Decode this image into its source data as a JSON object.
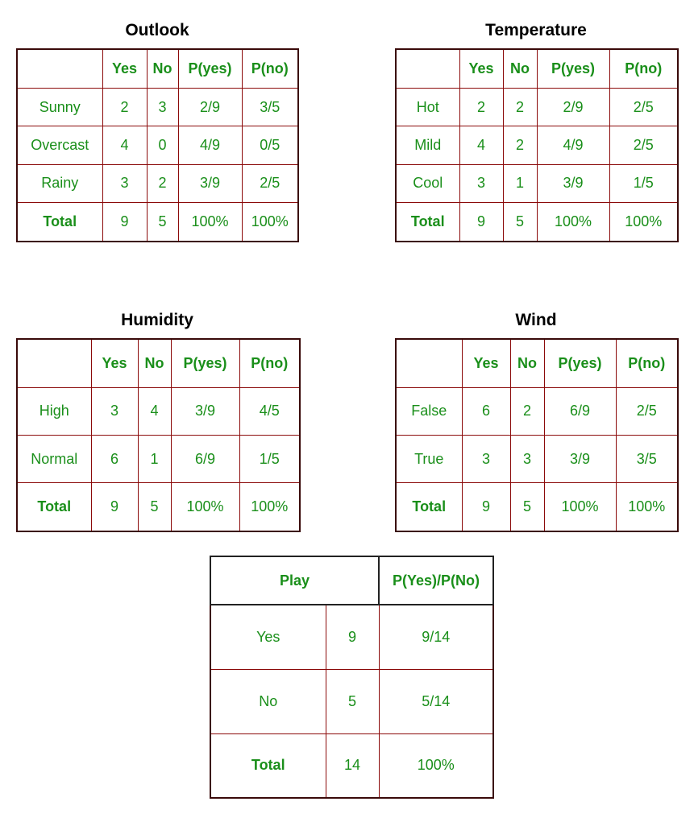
{
  "colors": {
    "text": "#1a8f1a",
    "grid": "#8b0a0a",
    "outer": "#3a0a0a"
  },
  "tables": {
    "outlook": {
      "title": "Outlook",
      "headers": [
        "",
        "Yes",
        "No",
        "P(yes)",
        "P(no)"
      ],
      "rows": [
        [
          "Sunny",
          "2",
          "3",
          "2/9",
          "3/5"
        ],
        [
          "Overcast",
          "4",
          "0",
          "4/9",
          "0/5"
        ],
        [
          "Rainy",
          "3",
          "2",
          "3/9",
          "2/5"
        ],
        [
          "Total",
          "9",
          "5",
          "100%",
          "100%"
        ]
      ]
    },
    "temperature": {
      "title": "Temperature",
      "headers": [
        "",
        "Yes",
        "No",
        "P(yes)",
        "P(no)"
      ],
      "rows": [
        [
          "Hot",
          "2",
          "2",
          "2/9",
          "2/5"
        ],
        [
          "Mild",
          "4",
          "2",
          "4/9",
          "2/5"
        ],
        [
          "Cool",
          "3",
          "1",
          "3/9",
          "1/5"
        ],
        [
          "Total",
          "9",
          "5",
          "100%",
          "100%"
        ]
      ]
    },
    "humidity": {
      "title": "Humidity",
      "headers": [
        "",
        "Yes",
        "No",
        "P(yes)",
        "P(no)"
      ],
      "rows": [
        [
          "High",
          "3",
          "4",
          "3/9",
          "4/5"
        ],
        [
          "Normal",
          "6",
          "1",
          "6/9",
          "1/5"
        ],
        [
          "Total",
          "9",
          "5",
          "100%",
          "100%"
        ]
      ]
    },
    "wind": {
      "title": "Wind",
      "headers": [
        "",
        "Yes",
        "No",
        "P(yes)",
        "P(no)"
      ],
      "rows": [
        [
          "False",
          "6",
          "2",
          "6/9",
          "2/5"
        ],
        [
          "True",
          "3",
          "3",
          "3/9",
          "3/5"
        ],
        [
          "Total",
          "9",
          "5",
          "100%",
          "100%"
        ]
      ]
    },
    "play": {
      "headers": [
        "Play",
        "P(Yes)/P(No)"
      ],
      "rows": [
        [
          "Yes",
          "9",
          "9/14"
        ],
        [
          "No",
          "5",
          "5/14"
        ],
        [
          "Total",
          "14",
          "100%"
        ]
      ]
    }
  }
}
